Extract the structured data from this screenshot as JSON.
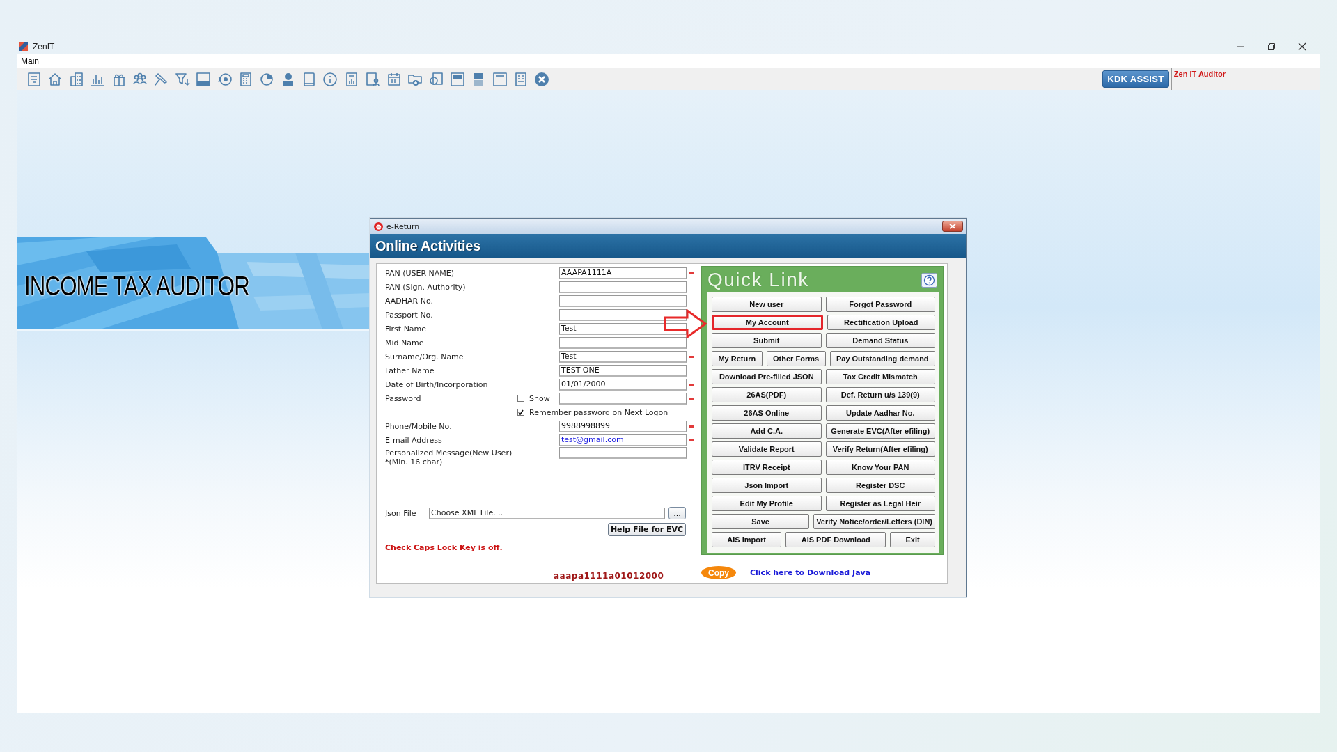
{
  "app": {
    "title": "ZenIT",
    "menu": [
      {
        "label": "Main"
      }
    ]
  },
  "toolbar": {
    "assist_button": "KDK ASSIST",
    "product_label": "Zen IT Auditor"
  },
  "banner": {
    "title": "INCOME TAX AUDITOR"
  },
  "dialog": {
    "title": "e-Return",
    "header": "Online Activities",
    "fields": [
      {
        "kind": "text",
        "label": "PAN (USER NAME)",
        "value": "AAAPA1111A",
        "required": true
      },
      {
        "kind": "text",
        "label": "PAN (Sign. Authority)",
        "required": false
      },
      {
        "kind": "text",
        "label": "AADHAR No.",
        "required": false
      },
      {
        "kind": "text",
        "label": "Passport No.",
        "required": false
      },
      {
        "kind": "text",
        "label": "First Name",
        "value": "Test",
        "required": false
      },
      {
        "kind": "text",
        "label": "Mid Name",
        "required": false
      },
      {
        "kind": "text",
        "label": "Surname/Org. Name",
        "value": "Test",
        "required": true
      },
      {
        "kind": "text",
        "label": "Father Name",
        "value": "TEST ONE",
        "required": false
      },
      {
        "kind": "text",
        "label": "Date of Birth/Incorporation",
        "value": "01/01/2000",
        "required": true
      },
      {
        "kind": "password",
        "label": "Password",
        "required": true,
        "show": {
          "label": "Show",
          "checked": false
        }
      },
      {
        "kind": "remember",
        "label": "Remember password on Next Logon",
        "checked": true
      },
      {
        "kind": "text",
        "label": "Phone/Mobile No.",
        "value": "9988998899",
        "required": true
      },
      {
        "kind": "email",
        "label": "E-mail Address",
        "value": "test@gmail.com",
        "required": true
      },
      {
        "kind": "message",
        "label": "Personalized Message(New User)",
        "note": "*(Min. 16 char)",
        "required": false
      }
    ],
    "json_file": {
      "label": "Json File",
      "placeholder": "Choose XML File....",
      "browse_button": "..."
    },
    "help_button": "Help File for EVC",
    "caps_warning": "Check Caps Lock Key is off.",
    "generated_code": "aaapa1111a01012000",
    "quick_link": {
      "title": "Quick Link",
      "rows": [
        [
          {
            "label": "New user",
            "highlighted": false
          },
          {
            "label": "Forgot Password",
            "highlighted": false
          }
        ],
        [
          {
            "label": "My Account",
            "highlighted": true
          },
          {
            "label": "Rectification Upload",
            "highlighted": false
          }
        ],
        [
          {
            "label": "Submit",
            "highlighted": false
          },
          {
            "label": "Demand Status",
            "highlighted": false
          }
        ],
        [
          {
            "label": "My Return",
            "highlighted": false
          },
          {
            "label": "Other Forms",
            "highlighted": false
          },
          {
            "label": "Pay Outstanding demand",
            "highlighted": false
          }
        ],
        [
          {
            "label": "Download Pre-filled JSON",
            "highlighted": false
          },
          {
            "label": "Tax Credit Mismatch",
            "highlighted": false
          }
        ],
        [
          {
            "label": "26AS(PDF)",
            "highlighted": false
          },
          {
            "label": "Def. Return u/s 139(9)",
            "highlighted": false
          }
        ],
        [
          {
            "label": "26AS Online",
            "highlighted": false
          },
          {
            "label": "Update Aadhar No.",
            "highlighted": false
          }
        ],
        [
          {
            "label": "Add C.A.",
            "highlighted": false
          },
          {
            "label": "Generate EVC(After efiling)",
            "highlighted": false
          }
        ],
        [
          {
            "label": "Validate Report",
            "highlighted": false
          },
          {
            "label": "Verify Return(After efiling)",
            "highlighted": false
          }
        ],
        [
          {
            "label": "ITRV Receipt",
            "highlighted": false
          },
          {
            "label": "Know Your PAN",
            "highlighted": false
          }
        ],
        [
          {
            "label": "Json Import",
            "highlighted": false
          },
          {
            "label": "Register DSC",
            "highlighted": false
          }
        ],
        [
          {
            "label": "Edit My Profile",
            "highlighted": false
          },
          {
            "label": "Register as Legal Heir",
            "highlighted": false
          }
        ],
        [
          {
            "label": "Save",
            "highlighted": false
          },
          {
            "label": "Verify Notice/order/Letters (DIN)",
            "highlighted": false
          }
        ],
        [
          {
            "label": "AIS Import",
            "highlighted": false
          },
          {
            "label": "AIS PDF Download",
            "highlighted": false
          },
          {
            "label": "Exit",
            "highlighted": false
          }
        ]
      ]
    },
    "copy_button": "Copy",
    "java_link": "Click here to Download Java"
  }
}
